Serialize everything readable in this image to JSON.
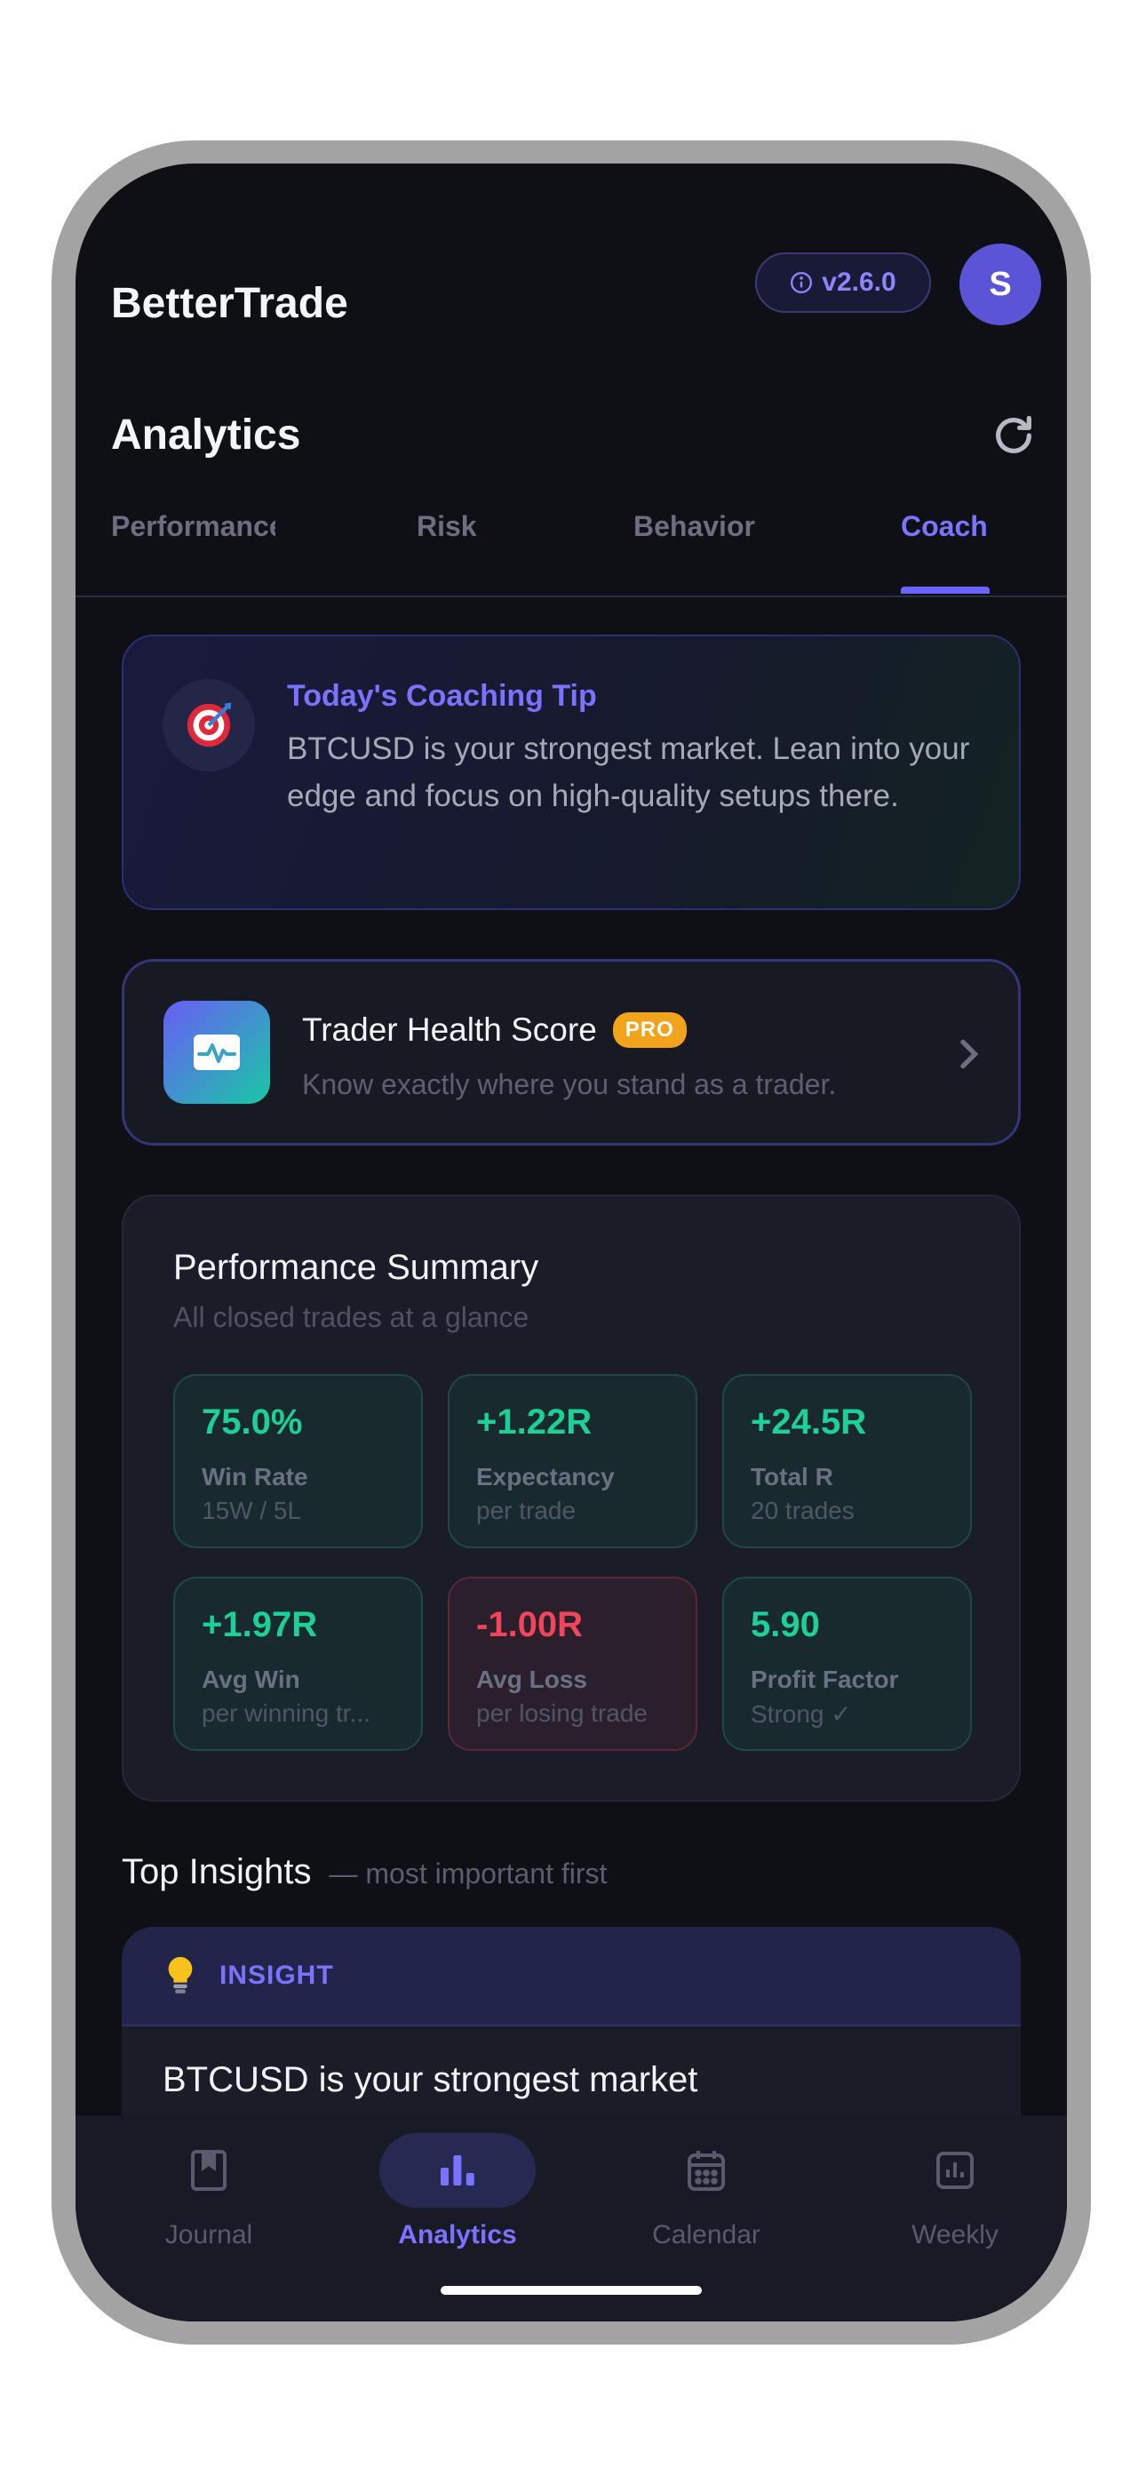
{
  "header": {
    "brand": "BetterTrade",
    "version": "v2.6.0",
    "avatar_initial": "S"
  },
  "page": {
    "title": "Analytics"
  },
  "tabs": [
    {
      "label": "Performance",
      "active": false
    },
    {
      "label": "Risk",
      "active": false
    },
    {
      "label": "Behavior",
      "active": false
    },
    {
      "label": "Coach",
      "active": true
    }
  ],
  "coaching_tip": {
    "emoji": "🎯",
    "title": "Today's Coaching Tip",
    "text": "BTCUSD is your strongest market. Lean into your edge and focus on high-quality setups there."
  },
  "health_score": {
    "title": "Trader Health Score",
    "badge": "PRO",
    "subtitle": "Know exactly where you stand as a trader."
  },
  "summary": {
    "title": "Performance Summary",
    "subtitle": "All closed trades at a glance",
    "stats": [
      {
        "value": "75.0%",
        "label": "Win Rate",
        "sub": "15W / 5L",
        "tone": "positive"
      },
      {
        "value": "+1.22R",
        "label": "Expectancy",
        "sub": "per trade",
        "tone": "positive"
      },
      {
        "value": "+24.5R",
        "label": "Total R",
        "sub": "20 trades",
        "tone": "positive"
      },
      {
        "value": "+1.97R",
        "label": "Avg Win",
        "sub": "per winning tr...",
        "tone": "positive"
      },
      {
        "value": "-1.00R",
        "label": "Avg Loss",
        "sub": "per losing trade",
        "tone": "negative"
      },
      {
        "value": "5.90",
        "label": "Profit Factor",
        "sub": "Strong ✓",
        "tone": "positive"
      }
    ]
  },
  "insights": {
    "title": "Top Insights",
    "subtitle": "— most important first",
    "card": {
      "emoji": "💡",
      "tag": "INSIGHT",
      "title": "BTCUSD is your strongest market"
    }
  },
  "nav": [
    {
      "label": "Journal",
      "icon": "bookmark-book-icon",
      "active": false
    },
    {
      "label": "Analytics",
      "icon": "bar-chart-icon",
      "active": true
    },
    {
      "label": "Calendar",
      "icon": "calendar-icon",
      "active": false
    },
    {
      "label": "Weekly",
      "icon": "chart-square-icon",
      "active": false
    }
  ],
  "colors": {
    "accent": "#7a73ff",
    "positive": "#1ecf97",
    "negative": "#f0455c",
    "pro_badge": "#f1a31c",
    "background": "#0e1016"
  }
}
